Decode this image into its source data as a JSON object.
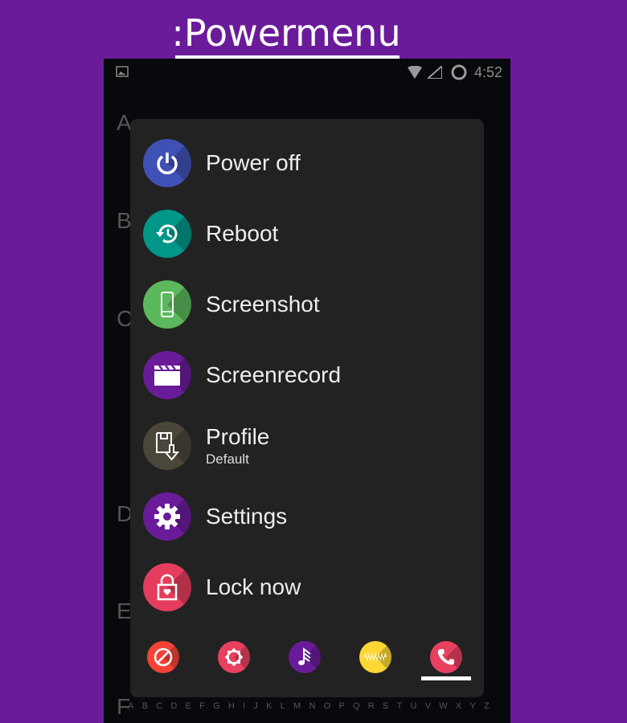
{
  "header": {
    "title": ":Powermenu"
  },
  "status_bar": {
    "time": "4:52",
    "icons": [
      "image-icon",
      "wifi-icon",
      "signal-icon",
      "battery-ring-icon"
    ]
  },
  "background": {
    "section_letters": [
      "A",
      "B",
      "C",
      "D",
      "E",
      "F"
    ],
    "alphabet": [
      "A",
      "B",
      "C",
      "D",
      "E",
      "F",
      "G",
      "H",
      "I",
      "J",
      "K",
      "L",
      "M",
      "N",
      "O",
      "P",
      "Q",
      "R",
      "S",
      "T",
      "U",
      "V",
      "W",
      "X",
      "Y",
      "Z"
    ]
  },
  "menu": {
    "items": [
      {
        "label": "Power off",
        "icon": "power-icon",
        "color": "#3f51b5"
      },
      {
        "label": "Reboot",
        "icon": "history-icon",
        "color": "#009688"
      },
      {
        "label": "Screenshot",
        "icon": "phone-icon",
        "color": "#5cb85c"
      },
      {
        "label": "Screenrecord",
        "icon": "clapperboard-icon",
        "color": "#6a1b9a"
      },
      {
        "label": "Profile",
        "sublabel": "Default",
        "icon": "save-download-icon",
        "color": "#4a473a"
      },
      {
        "label": "Settings",
        "icon": "gear-icon",
        "color": "#6a1b9a"
      },
      {
        "label": "Lock now",
        "icon": "lock-icon",
        "color": "#e53d5d"
      }
    ],
    "quick_toggles": [
      {
        "icon": "block-icon",
        "color": "#f44336"
      },
      {
        "icon": "brightness-icon",
        "color": "#e8405f"
      },
      {
        "icon": "music-note-icon",
        "color": "#6a1b9a"
      },
      {
        "icon": "vibrate-icon",
        "color": "#fdd835"
      },
      {
        "icon": "phone-call-icon",
        "color": "#e8405f",
        "selected": true
      }
    ]
  }
}
